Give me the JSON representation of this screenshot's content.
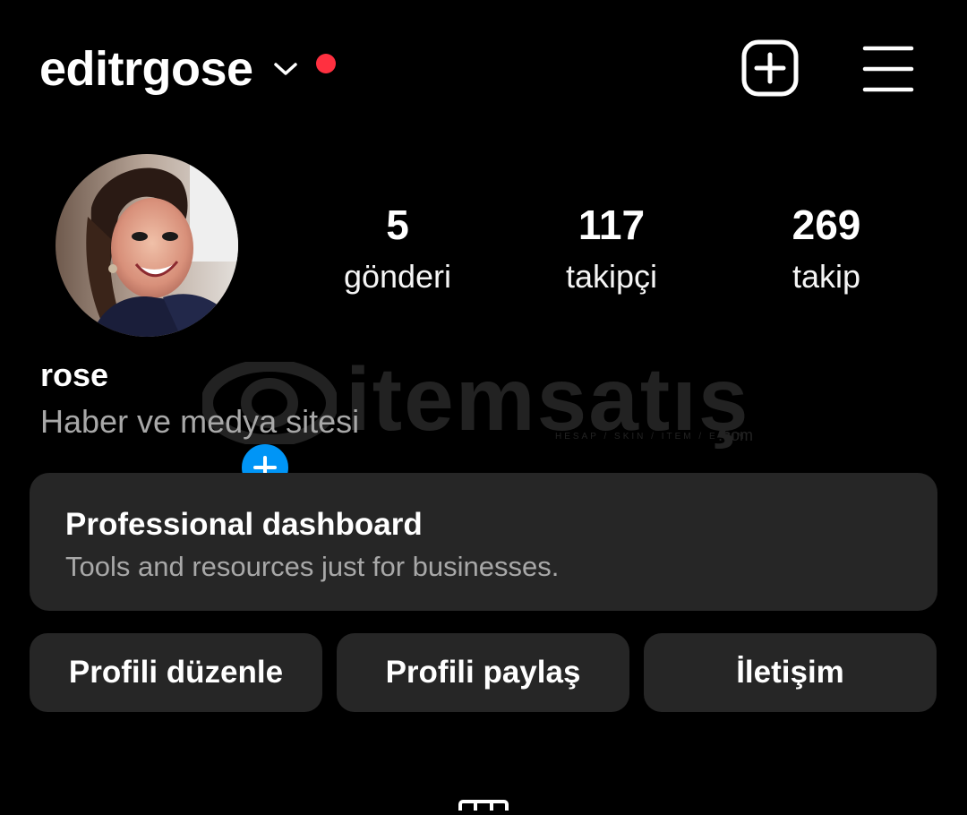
{
  "header": {
    "username": "editrgose",
    "icons": {
      "chevron": "chevron-down-icon",
      "notification": "notification-dot",
      "create": "add-post-icon",
      "menu": "hamburger-menu-icon"
    },
    "notification_color": "#ff3040"
  },
  "profile": {
    "avatar_icon": "profile-photo",
    "add_story_color": "#0095f6",
    "stats": [
      {
        "value": "5",
        "label": "gönderi"
      },
      {
        "value": "117",
        "label": "takipçi"
      },
      {
        "value": "269",
        "label": "takip"
      }
    ],
    "name": "rose",
    "bio": "Haber ve medya sitesi"
  },
  "watermark": {
    "text": "itemsatış",
    "sub": "HESAP / SKIN / ITEM / E-PIN",
    "com": ".com"
  },
  "professional": {
    "title": "Professional dashboard",
    "subtitle": "Tools and resources just for businesses."
  },
  "actions": {
    "edit": "Profili düzenle",
    "share": "Profili paylaş",
    "contact": "İletişim"
  },
  "tabs": {
    "grid_icon": "grid-icon"
  }
}
